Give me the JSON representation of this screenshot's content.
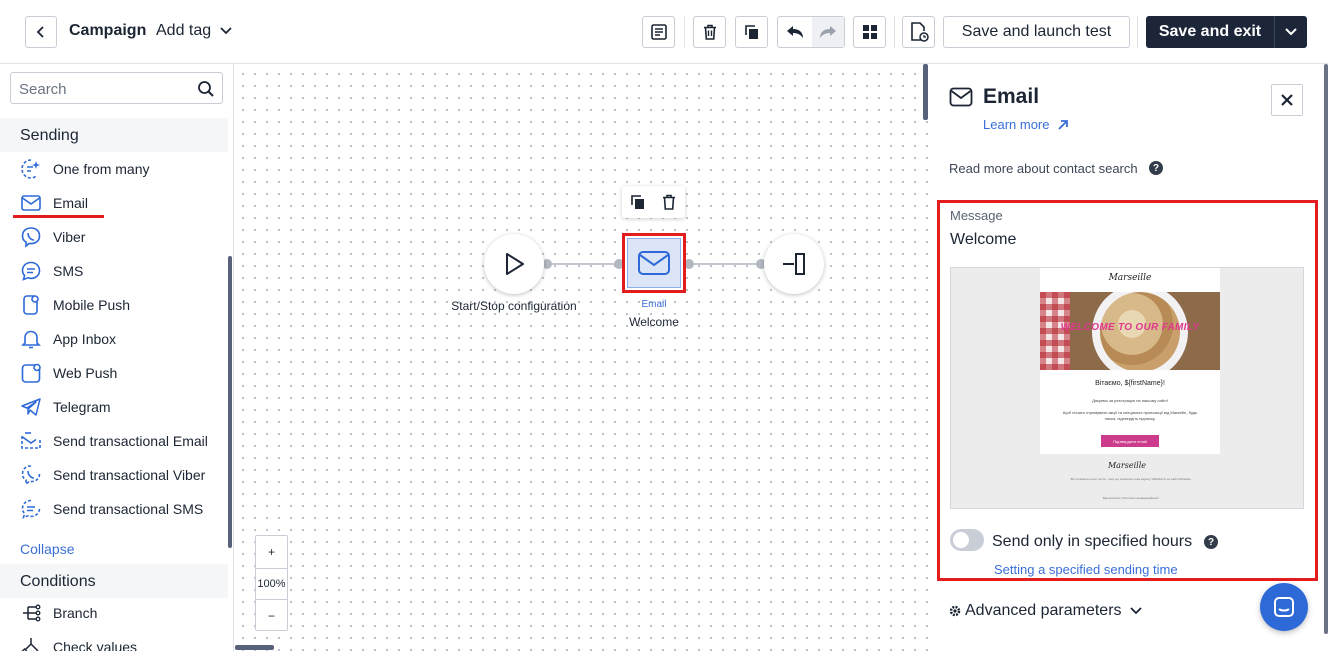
{
  "header": {
    "title": "Campaign",
    "campaign_name": "Add tag",
    "save_launch_label": "Save and launch test",
    "save_exit_label": "Save and exit"
  },
  "sidebar": {
    "search_placeholder": "Search",
    "sending_title": "Sending",
    "sending_items": [
      {
        "label": "One from many",
        "icon": "sparkle-icon"
      },
      {
        "label": "Email",
        "icon": "envelope-icon"
      },
      {
        "label": "Viber",
        "icon": "viber-icon"
      },
      {
        "label": "SMS",
        "icon": "sms-icon"
      },
      {
        "label": "Mobile Push",
        "icon": "mobile-push-icon"
      },
      {
        "label": "App Inbox",
        "icon": "bell-icon"
      },
      {
        "label": "Web Push",
        "icon": "web-push-icon"
      },
      {
        "label": "Telegram",
        "icon": "telegram-icon"
      },
      {
        "label": "Send transactional Email",
        "icon": "transactional-email-icon"
      },
      {
        "label": "Send transactional Viber",
        "icon": "transactional-viber-icon"
      },
      {
        "label": "Send transactional SMS",
        "icon": "transactional-sms-icon"
      }
    ],
    "collapse_label": "Collapse",
    "conditions_title": "Conditions",
    "conditions_items": [
      {
        "label": "Branch",
        "icon": "branch-icon"
      },
      {
        "label": "Check values",
        "icon": "check-values-icon"
      }
    ]
  },
  "canvas": {
    "start_node_label": "Start/Stop configuration",
    "email_node_type": "Email",
    "email_node_name": "Welcome",
    "zoom_in": "+",
    "zoom_level": "100%",
    "zoom_out": "−"
  },
  "panel": {
    "title": "Email",
    "learn_more": "Learn more",
    "read_more": "Read more about contact search",
    "message_label": "Message",
    "message_name": "Welcome",
    "preview": {
      "brand": "Marseille",
      "hero_text": "WELCOME TO OUR FAMILY",
      "greeting": "Вітаємо, ${firstName}!",
      "line1": "Дякуємо за реєстрацію на нашому сайті!",
      "line2": "Щоб почати отримувати акції та спеціальні пропозиції від Marseille, будь ласка, підтвердіть підписку.",
      "button": "Підтвердити email",
      "footer_brand": "Marseille",
      "footer_text": "Ви отримали цього листа, тому що залишили нам адресу %EMAIL% на сайті Marseille.",
      "footer_links": "Відписатися  |  Політика конфіденційності"
    },
    "toggle_label": "Send only in specified hours",
    "toggle_on": false,
    "sending_time_link": "Setting a specified sending time",
    "advanced_label": "Advanced parameters"
  },
  "colors": {
    "accent_blue": "#3a6fd8",
    "dark_button": "#1c2638",
    "highlight_red": "#e31d1d",
    "chat_button": "#2d6ad8"
  }
}
